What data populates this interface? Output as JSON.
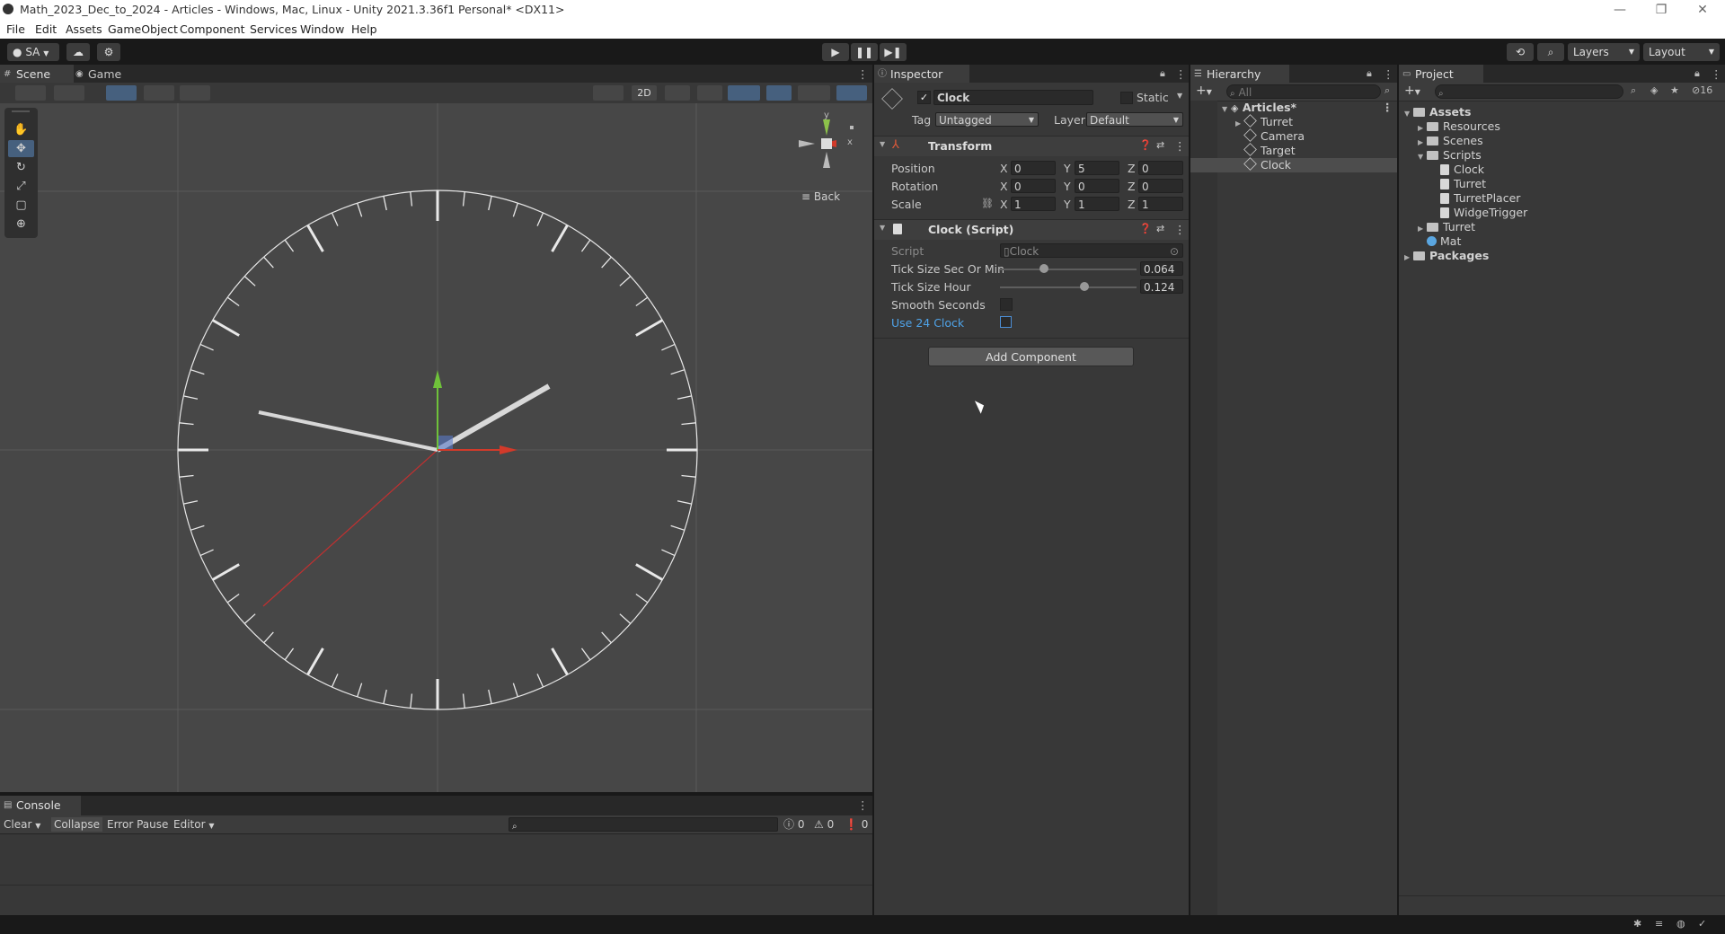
{
  "window": {
    "title": "Math_2023_Dec_to_2024 - Articles - Windows, Mac, Linux - Unity 2021.3.36f1 Personal* <DX11>",
    "controls": [
      "—",
      "❐",
      "✕"
    ]
  },
  "menu": [
    "File",
    "Edit",
    "Assets",
    "GameObject",
    "Component",
    "Services",
    "Window",
    "Help"
  ],
  "toolbar": {
    "account": "SA",
    "play_icon": "play-icon",
    "pause_icon": "pause-icon",
    "step_icon": "step-icon",
    "layers_label": "Layers",
    "layout_label": "Layout"
  },
  "scene_tabs": [
    {
      "label": "Scene",
      "icon": "scene-icon"
    },
    {
      "label": "Game",
      "icon": "game-icon"
    }
  ],
  "scene_toolbar": {
    "mode_2d": "2D"
  },
  "gizmo": {
    "y_label": "y",
    "x_label": "x",
    "view_label": "Back"
  },
  "clock": {
    "hour_hand_angle_deg": 60,
    "minute_hand_angle_deg": -78,
    "tick_count": 60
  },
  "console": {
    "tab_label": "Console",
    "clear": "Clear",
    "collapse": "Collapse",
    "error_pause": "Error Pause",
    "editor": "Editor",
    "search_placeholder": "",
    "info_count": "0",
    "warning_count": "0",
    "error_count": "0"
  },
  "inspector": {
    "tab_label": "Inspector",
    "object_name": "Clock",
    "active": true,
    "static_label": "Static",
    "tag_label": "Tag",
    "tag_value": "Untagged",
    "layer_label": "Layer",
    "layer_value": "Default",
    "transform": {
      "title": "Transform",
      "position_label": "Position",
      "rotation_label": "Rotation",
      "scale_label": "Scale",
      "position": {
        "x": "0",
        "y": "5",
        "z": "0"
      },
      "rotation": {
        "x": "0",
        "y": "0",
        "z": "0"
      },
      "scale": {
        "x": "1",
        "y": "1",
        "z": "1"
      },
      "axis_x": "X",
      "axis_y": "Y",
      "axis_z": "Z"
    },
    "clock_script": {
      "title": "Clock (Script)",
      "script_label": "Script",
      "script_value": "Clock",
      "tick_sec_label": "Tick Size Sec Or Min",
      "tick_sec_value": "0.064",
      "tick_sec_fraction": 0.32,
      "tick_hour_label": "Tick Size Hour",
      "tick_hour_value": "0.124",
      "tick_hour_fraction": 0.62,
      "smooth_label": "Smooth Seconds",
      "smooth_checked": false,
      "use24_label": "Use 24 Clock",
      "use24_checked": false
    },
    "add_component": "Add Component"
  },
  "hierarchy": {
    "tab_label": "Hierarchy",
    "search_placeholder": "All",
    "scene_name": "Articles*",
    "items": [
      "Turret",
      "Camera",
      "Target",
      "Clock"
    ],
    "selected": "Clock"
  },
  "project": {
    "tab_label": "Project",
    "hidden_count": "16",
    "tree": {
      "assets": "Assets",
      "resources": "Resources",
      "scenes": "Scenes",
      "scripts": "Scripts",
      "script_files": [
        "Clock",
        "Turret",
        "TurretPlacer",
        "WidgeTrigger"
      ],
      "turret": "Turret",
      "mat": "Mat",
      "packages": "Packages"
    }
  }
}
